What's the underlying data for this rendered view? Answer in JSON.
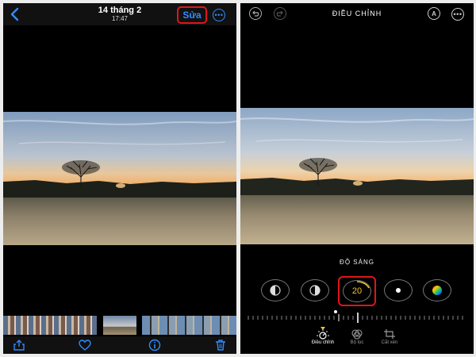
{
  "left_screen": {
    "header": {
      "date": "14 tháng 2",
      "time": "17:47",
      "edit_label": "Sửa",
      "more_label": "•••"
    },
    "toolbar": {
      "icons": [
        "share-icon",
        "heart-icon",
        "info-icon",
        "trash-icon"
      ]
    }
  },
  "right_screen": {
    "header": {
      "title": "ĐIỀU CHỈNH",
      "auto_label": "A",
      "more_label": "•••"
    },
    "adjust": {
      "label": "ĐỘ SÁNG",
      "value": "20"
    },
    "tabs": [
      {
        "label": "Điều chỉnh",
        "active": true
      },
      {
        "label": "Bộ lọc",
        "active": false
      },
      {
        "label": "Cắt xén",
        "active": false
      }
    ]
  },
  "colors": {
    "accent_blue": "#2f8cff",
    "highlight_red": "#e0141b",
    "value_yellow": "#f2c335"
  }
}
